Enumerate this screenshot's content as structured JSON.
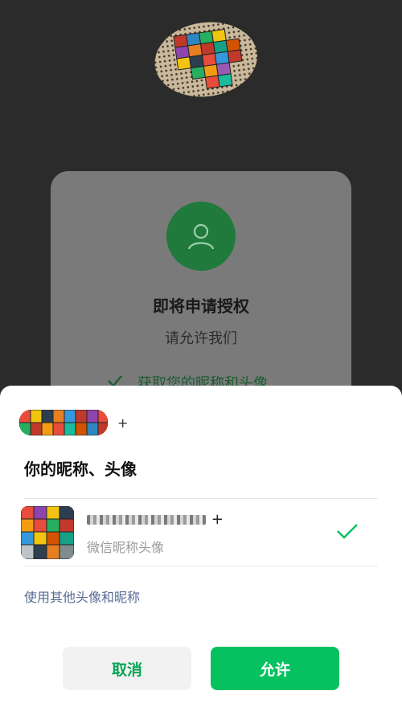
{
  "auth_card": {
    "title": "即将申请授权",
    "subtitle": "请允许我们",
    "permission": "获取您的昵称和头像"
  },
  "sheet": {
    "app_name": "+",
    "section_title": "你的昵称、头像",
    "profile": {
      "name": "+",
      "description": "微信昵称头像"
    },
    "other_link": "使用其他头像和昵称",
    "buttons": {
      "cancel": "取消",
      "allow": "允许"
    }
  },
  "icons": {
    "user_icon": "user-icon",
    "check_icon": "check-icon"
  },
  "colors": {
    "wechat_green": "#07c160",
    "link_blue": "#576b95",
    "overlay_card": "#7a7a7a",
    "dim_green": "#1f7a3c"
  }
}
